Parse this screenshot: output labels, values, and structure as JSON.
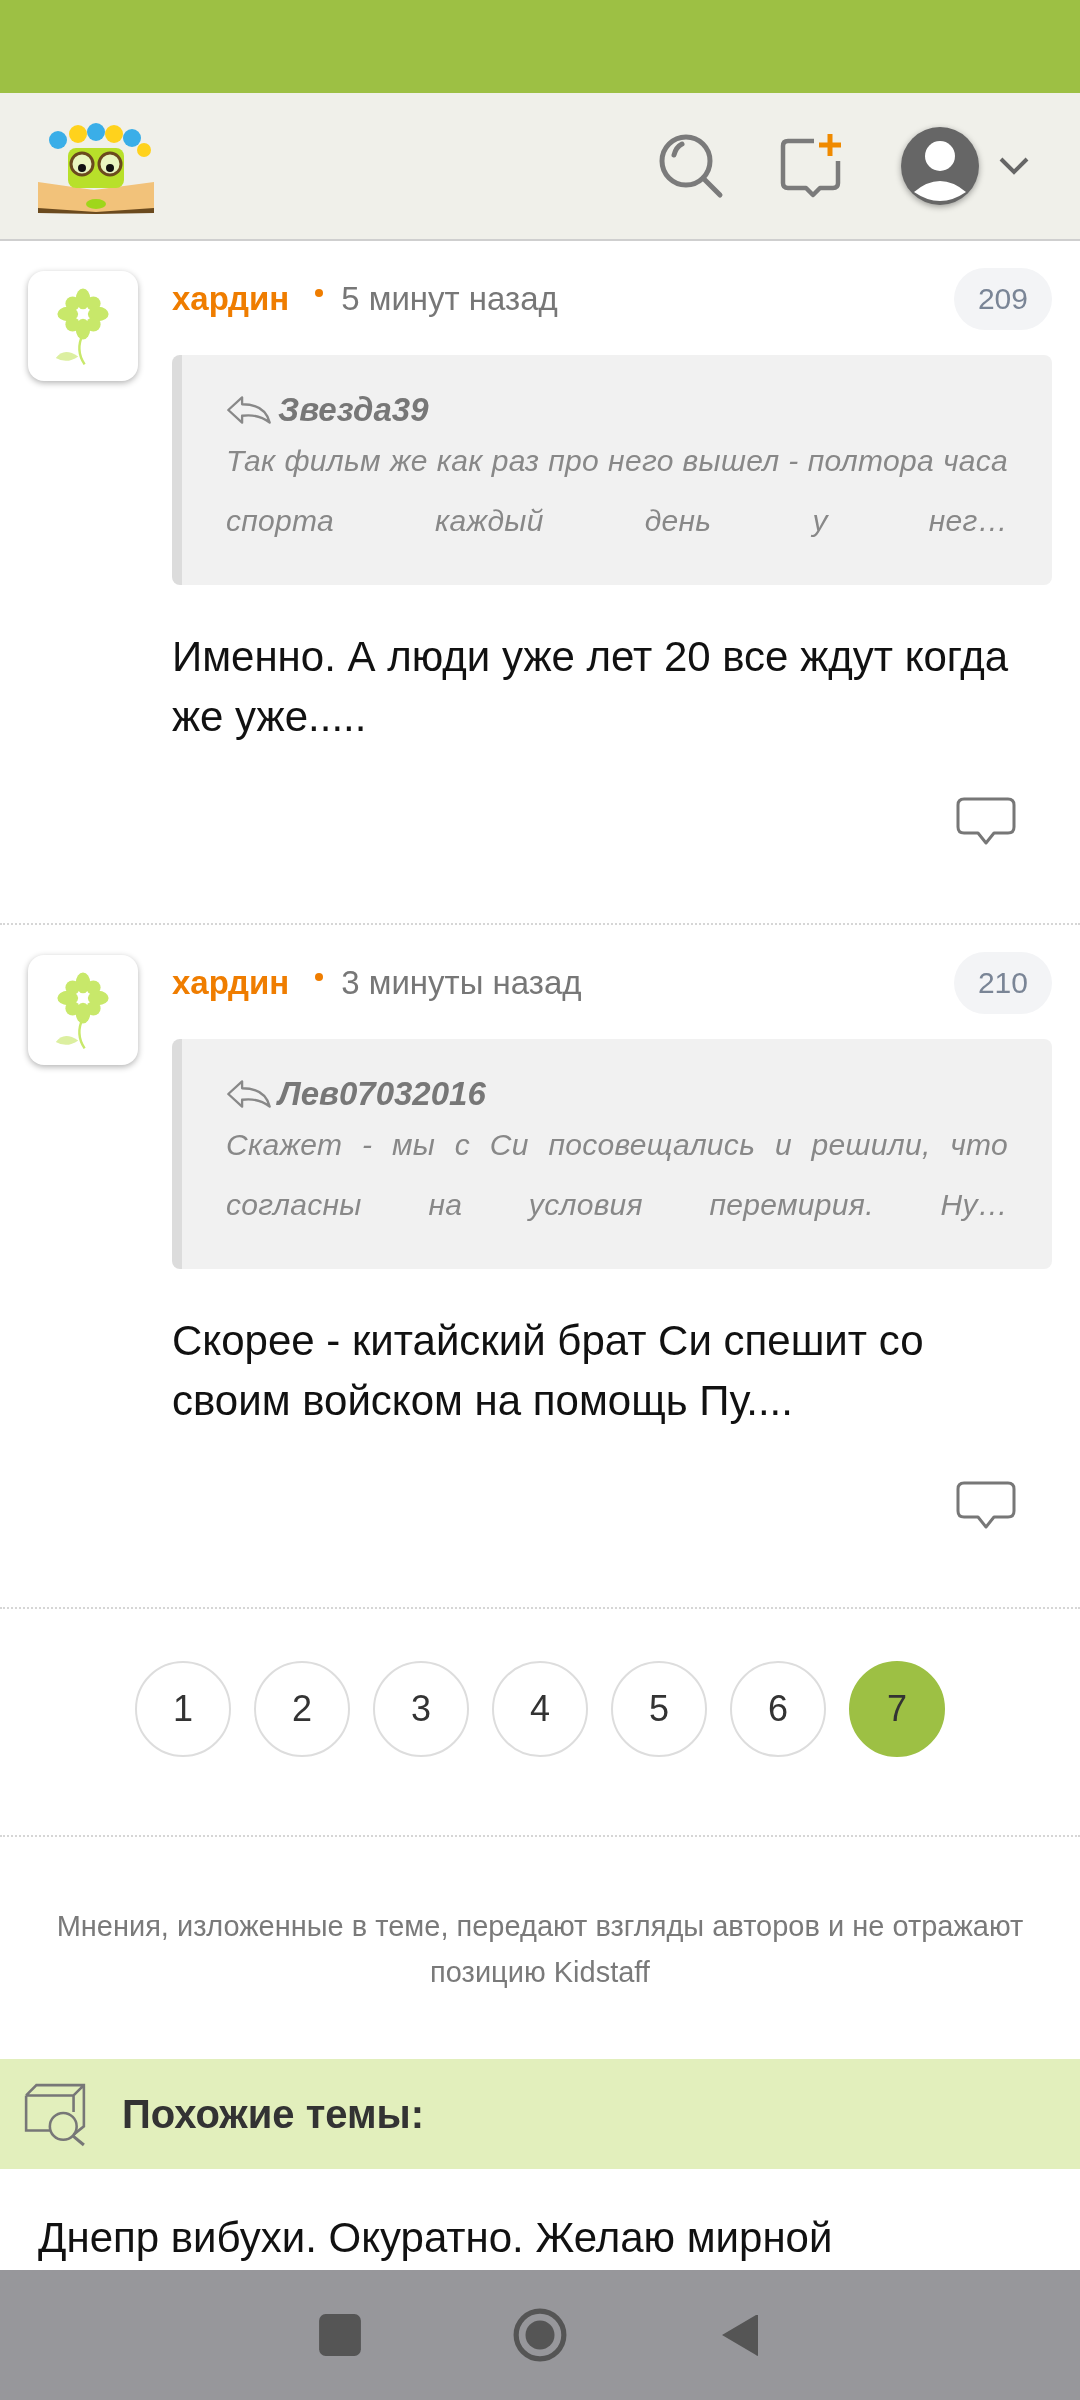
{
  "comments": [
    {
      "author": "хардин",
      "time": "5 минут назад",
      "number": "209",
      "quote": {
        "author": "Звезда39",
        "text": "Так фильм же как раз про него вышел - полтора часа спорта каждый день у нег…"
      },
      "text": "Именно. А люди уже лет 20 все ждут когда же уже....."
    },
    {
      "author": "хардин",
      "time": "3 минуты назад",
      "number": "210",
      "quote": {
        "author": "Лев07032016",
        "text": "Скажет - мы с Си посовещались и решили, что согласны на условия перемирия. Ну…"
      },
      "text": "Скорее - китайский брат Си спешит со своим войском на помощь Пу...."
    }
  ],
  "pagination": [
    {
      "label": "1",
      "selected": false
    },
    {
      "label": "2",
      "selected": false
    },
    {
      "label": "3",
      "selected": false
    },
    {
      "label": "4",
      "selected": false
    },
    {
      "label": "5",
      "selected": false
    },
    {
      "label": "6",
      "selected": false
    },
    {
      "label": "7",
      "selected": true
    }
  ],
  "disclaimer": "Мнения, изложенные в теме, передают взгляды авторов и не отражают позицию Kidstaff",
  "similar": {
    "title": "Похожие темы:",
    "items": [
      "Днепр вибухи. Окуратно. Желаю мирной"
    ]
  }
}
